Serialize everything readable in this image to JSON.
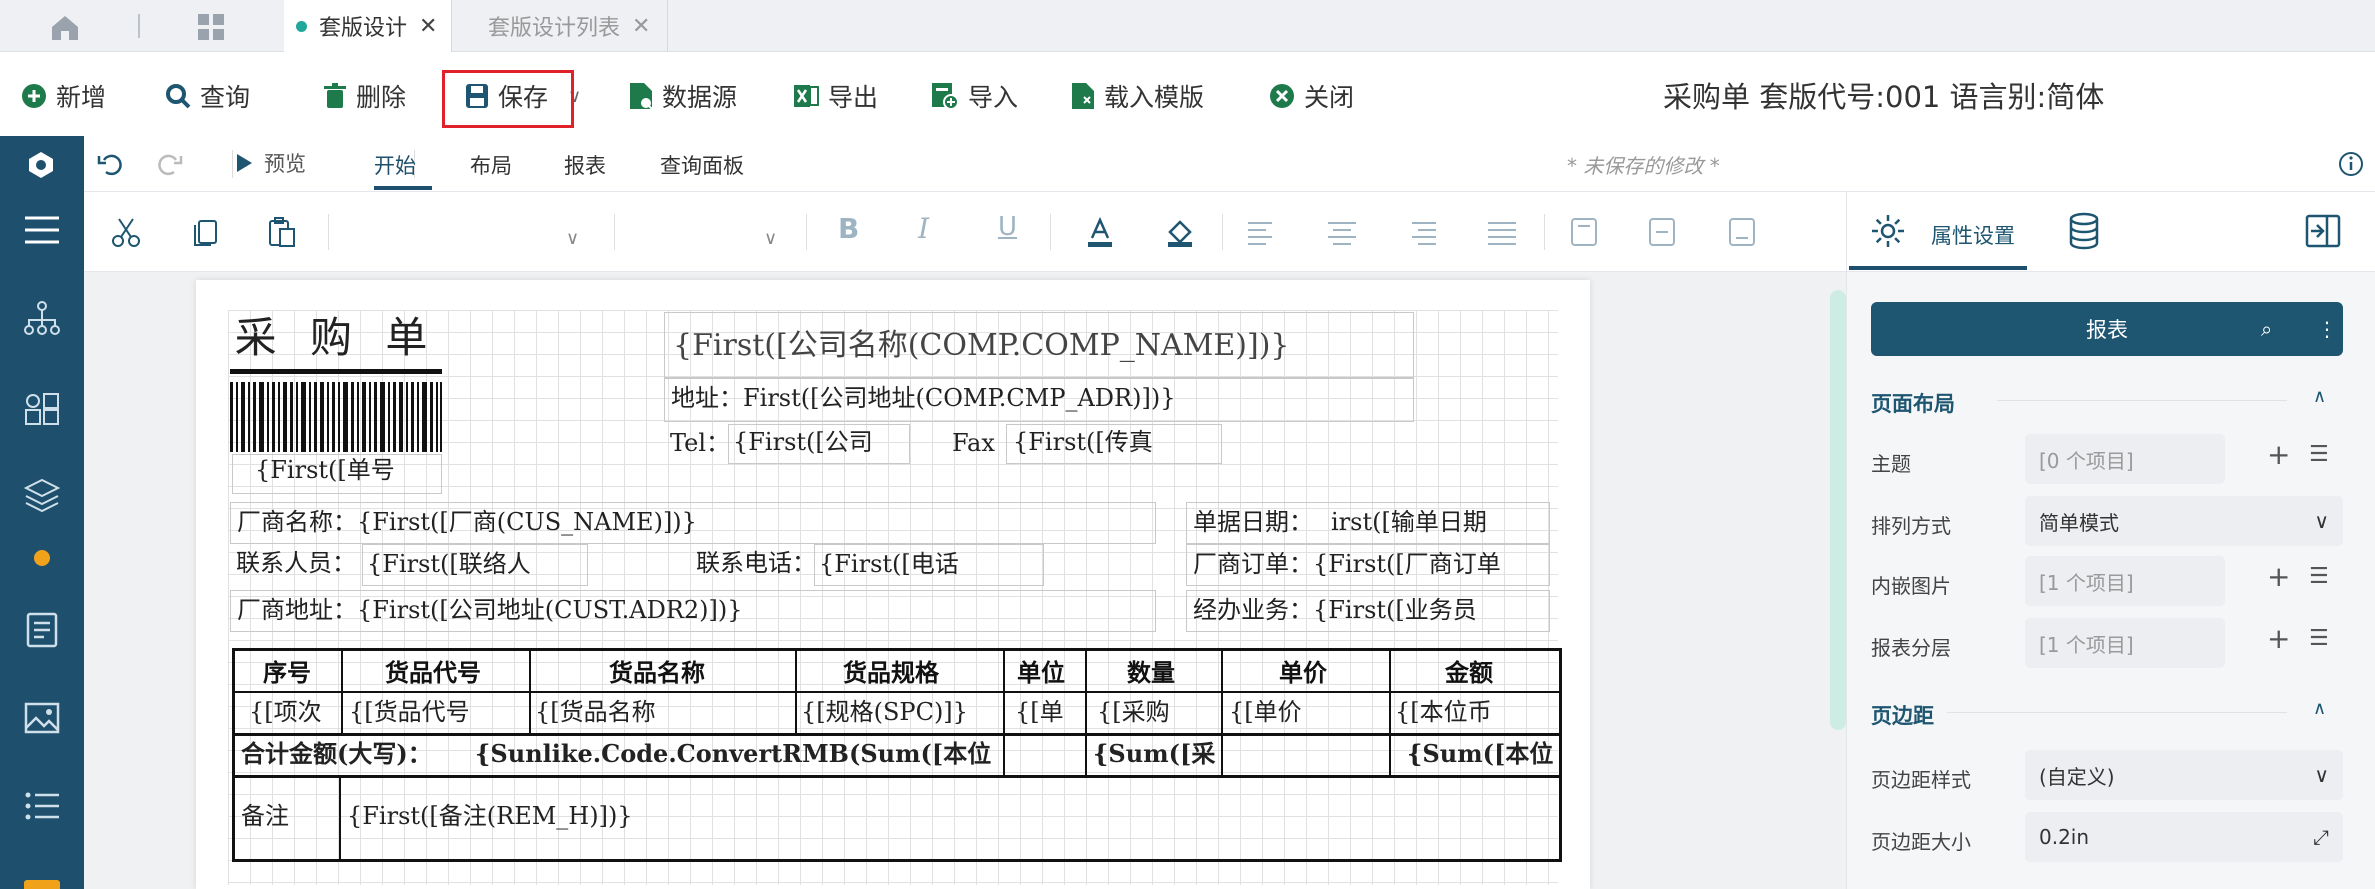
{
  "tabs": {
    "active": "套版设计",
    "inactive": "套版设计列表"
  },
  "toolbar": {
    "add": "新增",
    "query": "查询",
    "delete": "删除",
    "save": "保存",
    "datasource": "数据源",
    "export": "导出",
    "import": "导入",
    "load_template": "载入模版",
    "close": "关闭"
  },
  "doc_title": "采购单 套版代号:001 语言别:简体",
  "ribbon": {
    "preview": "预览",
    "tabs": [
      "开始",
      "布局",
      "报表",
      "查询面板"
    ],
    "unsaved": "* 未保存的修改 *"
  },
  "panel": {
    "tab_label": "属性设置",
    "report_button": "报表",
    "sec_layout": "页面布局",
    "sec_margin": "页边距",
    "rows": [
      {
        "label": "主题",
        "value": "[0 个项目]"
      },
      {
        "label": "排列方式",
        "value": "简单模式"
      },
      {
        "label": "内嵌图片",
        "value": "[1 个项目]"
      },
      {
        "label": "报表分层",
        "value": "[1 个项目]"
      },
      {
        "label": "页边距样式",
        "value": "(自定义)"
      },
      {
        "label": "页边距大小",
        "value": "0.2in"
      }
    ]
  },
  "report": {
    "title": "采 购 单",
    "company": "{First([公司名称(COMP.COMP_NAME)])}",
    "addr_label": "地址：",
    "addr": "First([公司地址(COMP.CMP_ADR)])}",
    "tel_label": "Tel：",
    "tel": "{First([公司",
    "fax_label": "Fax",
    "fax": "{First([传真",
    "billno": "{First([单号",
    "vendor_label": "厂商名称：",
    "vendor": "{First([厂商(CUS_NAME)])}",
    "date_label": "单据日期：",
    "date": "irst([输单日期",
    "contact_label": "联系人员：",
    "contact": "{First([联络人",
    "phone_label": "联系电话：",
    "phone": "{First([电话",
    "vendor_order_label": "厂商订单：",
    "vendor_order": "{First([厂商订单",
    "vaddr_label": "厂商地址：",
    "vaddr": "{First([公司地址(CUST.ADR2)])}",
    "handler_label": "经办业务：",
    "handler": "{First([业务员",
    "headers": [
      "序号",
      "货品代号",
      "货品名称",
      "货品规格",
      "单位",
      "数量",
      "单价",
      "金额"
    ],
    "cells": [
      "{[项次",
      "{[货品代号",
      "{[货品名称",
      "{[规格(SPC)]}",
      "{[单",
      "{[采购",
      "{[单价",
      "{[本位币"
    ],
    "total_label": "合计金额(大写)：",
    "total_expr": "{Sunlike.Code.ConvertRMB(Sum([本位",
    "total_qty": "{Sum([采",
    "total_amt": "{Sum([本位",
    "remark_label": "备注",
    "remark": "{First([备注(REM_H)])}"
  }
}
